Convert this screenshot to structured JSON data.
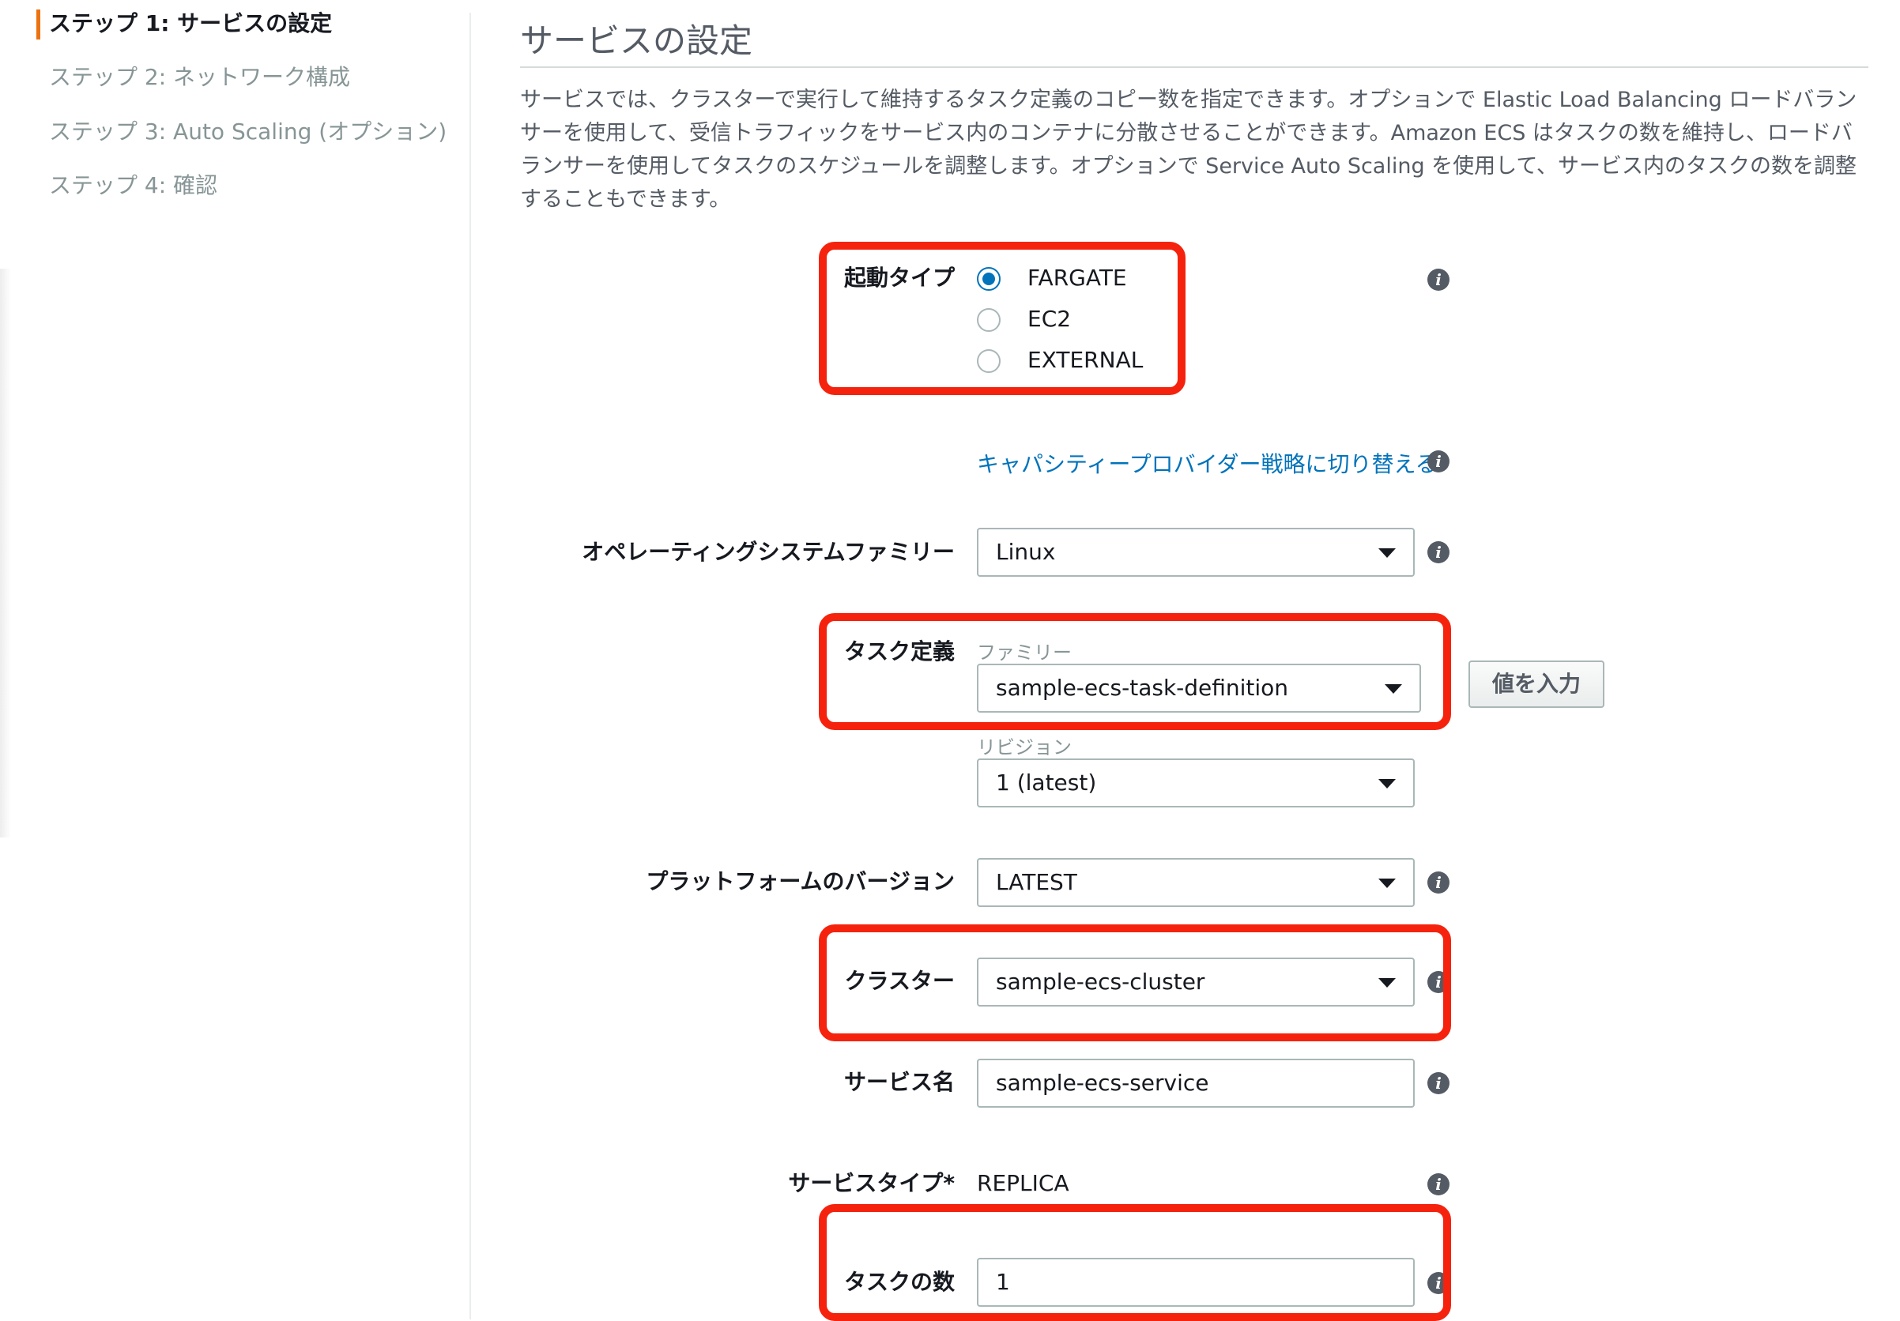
{
  "steps": [
    {
      "label": "ステップ 1: サービスの設定",
      "active": true
    },
    {
      "label": "ステップ 2: ネットワーク構成",
      "active": false
    },
    {
      "label": "ステップ 3: Auto Scaling (オプション)",
      "active": false
    },
    {
      "label": "ステップ 4: 確認",
      "active": false
    }
  ],
  "page": {
    "title": "サービスの設定",
    "description": "サービスでは、クラスターで実行して維持するタスク定義のコピー数を指定できます。オプションで Elastic Load Balancing ロードバランサーを使用して、受信トラフィックをサービス内のコンテナに分散させることができます。Amazon ECS はタスクの数を維持し、ロードバランサーを使用してタスクのスケジュールを調整します。オプションで Service Auto Scaling を使用して、サービス内のタスクの数を調整することもできます。"
  },
  "form": {
    "launch_type": {
      "label": "起動タイプ",
      "options": [
        "FARGATE",
        "EC2",
        "EXTERNAL"
      ],
      "selected": "FARGATE"
    },
    "capacity_link": "キャパシティープロバイダー戦略に切り替える",
    "os_family": {
      "label": "オペレーティングシステムファミリー",
      "value": "Linux"
    },
    "task_definition": {
      "label": "タスク定義",
      "family_label": "ファミリー",
      "family_value": "sample-ecs-task-definition",
      "enter_value_button": "値を入力",
      "revision_label": "リビジョン",
      "revision_value": "1 (latest)"
    },
    "platform_version": {
      "label": "プラットフォームのバージョン",
      "value": "LATEST"
    },
    "cluster": {
      "label": "クラスター",
      "value": "sample-ecs-cluster"
    },
    "service_name": {
      "label": "サービス名",
      "value": "sample-ecs-service"
    },
    "service_type": {
      "label": "サービスタイプ*",
      "value": "REPLICA"
    },
    "task_count": {
      "label": "タスクの数",
      "value": "1"
    }
  },
  "colors": {
    "accent": "#ec7211",
    "link": "#0073bb",
    "highlight": "#f5230d"
  },
  "icons": {
    "info": "info-icon",
    "dropdown": "caret-down-icon"
  }
}
